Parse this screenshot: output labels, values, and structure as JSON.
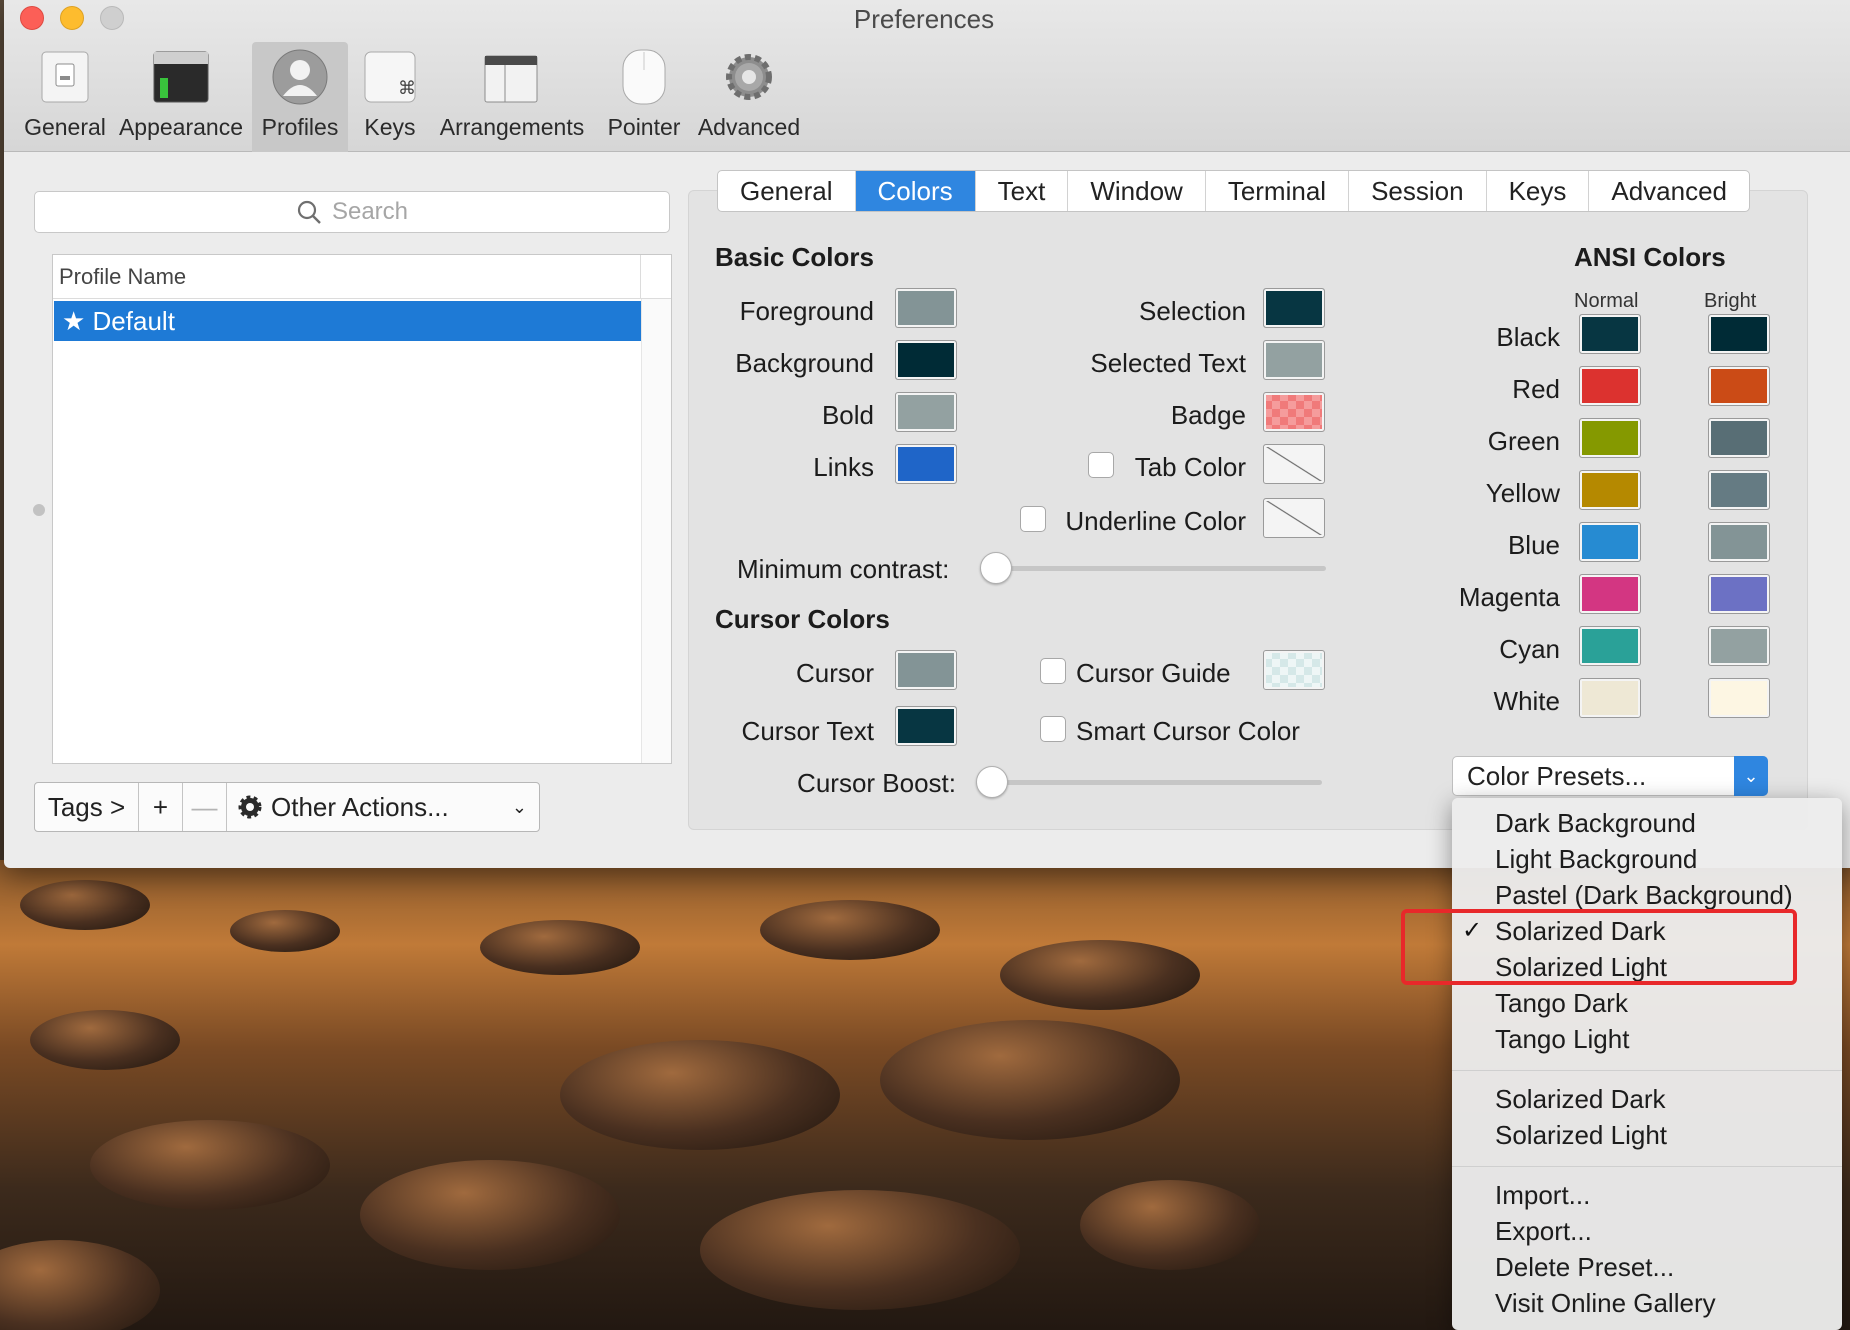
{
  "window": {
    "title": "Preferences"
  },
  "toolbar": {
    "items": [
      {
        "label": "General",
        "icon": "general-icon"
      },
      {
        "label": "Appearance",
        "icon": "appearance-icon"
      },
      {
        "label": "Profiles",
        "icon": "profiles-icon",
        "selected": true
      },
      {
        "label": "Keys",
        "icon": "keys-icon"
      },
      {
        "label": "Arrangements",
        "icon": "arrangements-icon"
      },
      {
        "label": "Pointer",
        "icon": "pointer-icon"
      },
      {
        "label": "Advanced",
        "icon": "advanced-gear-icon"
      }
    ]
  },
  "left": {
    "search_placeholder": "Search",
    "list_header": "Profile Name",
    "profiles": [
      {
        "label": "★ Default",
        "selected": true
      }
    ],
    "buttons": {
      "tags": "Tags >",
      "add": "+",
      "remove": "—",
      "other_actions": "Other Actions..."
    }
  },
  "tabs": [
    {
      "label": "General"
    },
    {
      "label": "Colors",
      "active": true
    },
    {
      "label": "Text"
    },
    {
      "label": "Window"
    },
    {
      "label": "Terminal"
    },
    {
      "label": "Session"
    },
    {
      "label": "Keys"
    },
    {
      "label": "Advanced"
    }
  ],
  "basic_colors": {
    "title": "Basic Colors",
    "left": [
      {
        "label": "Foreground",
        "color": "#839496"
      },
      {
        "label": "Background",
        "color": "#002b36"
      },
      {
        "label": "Bold",
        "color": "#93a1a1"
      },
      {
        "label": "Links",
        "color": "#1f65c8"
      }
    ],
    "right": [
      {
        "label": "Selection",
        "color": "#073642"
      },
      {
        "label": "Selected Text",
        "color": "#93a1a1"
      },
      {
        "label": "Badge",
        "color": "#f08080"
      },
      {
        "label": "Tab Color",
        "checked": false
      },
      {
        "label": "Underline Color",
        "checked": false
      }
    ],
    "minimum_contrast_label": "Minimum contrast:",
    "minimum_contrast_value": 0
  },
  "cursor_colors": {
    "title": "Cursor Colors",
    "cursor_label": "Cursor",
    "cursor_color": "#839496",
    "cursor_text_label": "Cursor Text",
    "cursor_text_color": "#073642",
    "cursor_guide_label": "Cursor Guide",
    "cursor_guide_checked": false,
    "smart_cursor_label": "Smart Cursor Color",
    "smart_cursor_checked": false,
    "cursor_boost_label": "Cursor Boost:",
    "cursor_boost_value": 0
  },
  "ansi_colors": {
    "title": "ANSI Colors",
    "normal_header": "Normal",
    "bright_header": "Bright",
    "rows": [
      {
        "label": "Black",
        "normal": "#073642",
        "bright": "#002b36"
      },
      {
        "label": "Red",
        "normal": "#dc322f",
        "bright": "#cb4b16"
      },
      {
        "label": "Green",
        "normal": "#859900",
        "bright": "#586e75"
      },
      {
        "label": "Yellow",
        "normal": "#b58900",
        "bright": "#657b83"
      },
      {
        "label": "Blue",
        "normal": "#268bd2",
        "bright": "#839496"
      },
      {
        "label": "Magenta",
        "normal": "#d33682",
        "bright": "#6c71c4"
      },
      {
        "label": "Cyan",
        "normal": "#2aa198",
        "bright": "#93a1a1"
      },
      {
        "label": "White",
        "normal": "#eee8d5",
        "bright": "#fdf6e3"
      }
    ]
  },
  "presets": {
    "button_label": "Color Presets...",
    "group1": [
      "Dark Background",
      "Light Background",
      "Pastel (Dark Background)",
      "Solarized Dark",
      "Solarized Light",
      "Tango Dark",
      "Tango Light"
    ],
    "checked_item": "Solarized Dark",
    "group2": [
      "Solarized Dark",
      "Solarized Light"
    ],
    "group3": [
      "Import...",
      "Export...",
      "Delete Preset...",
      "Visit Online Gallery"
    ]
  },
  "colors": {
    "accent": "#2f86e0",
    "highlight_border": "#e8282a"
  }
}
